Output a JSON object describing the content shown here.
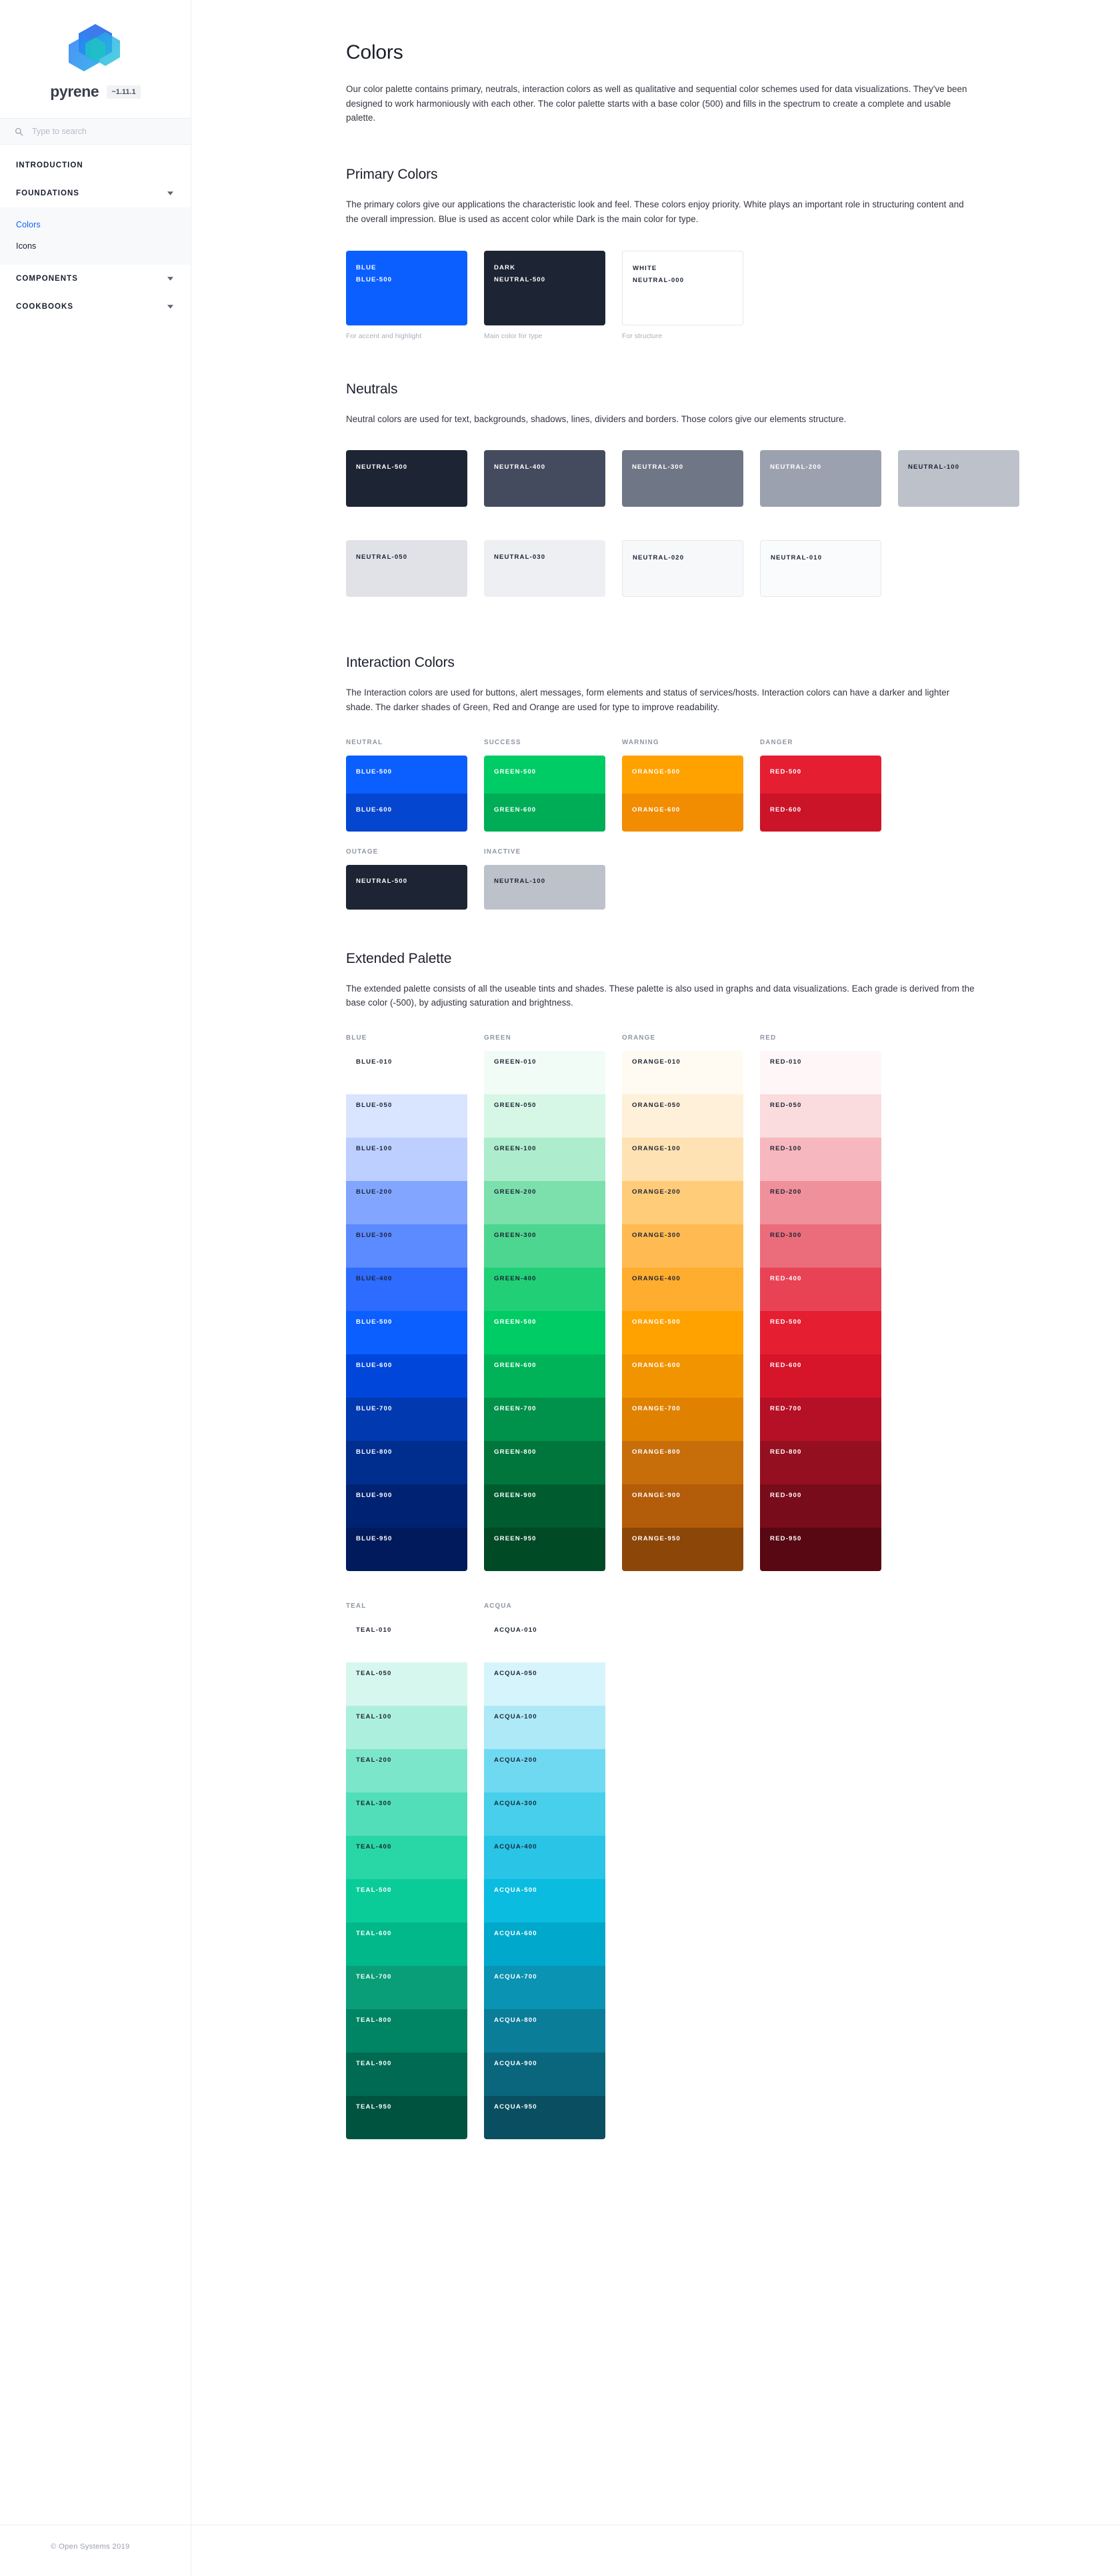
{
  "sidebar": {
    "brand": {
      "name": "pyrene",
      "version": "~1.11.1",
      "logo_icon": "pyrene-cube-logo"
    },
    "search": {
      "placeholder": "Type to search",
      "value": "",
      "icon": "search-icon"
    },
    "nav": [
      {
        "label": "INTRODUCTION",
        "expanded": false,
        "chevron": null,
        "items": []
      },
      {
        "label": "FOUNDATIONS",
        "expanded": true,
        "chevron": "chevron-up-icon",
        "items": [
          {
            "label": "Colors",
            "active": true
          },
          {
            "label": "Icons",
            "active": false
          }
        ]
      },
      {
        "label": "COMPONENTS",
        "expanded": false,
        "chevron": "chevron-down-icon",
        "items": []
      },
      {
        "label": "COOKBOOKS",
        "expanded": false,
        "chevron": "chevron-down-icon",
        "items": []
      }
    ]
  },
  "page": {
    "title": "Colors",
    "lede": "Our color palette contains primary, neutrals, interaction colors as well as qualitative and sequential color schemes used for data visualizations. They've been designed to work harmoniously with each other. The color palette starts with a base color (500) and fills in the spectrum to create a complete and usable palette."
  },
  "primary": {
    "title": "Primary Colors",
    "description": "The primary colors give our applications the characteristic look and feel. These colors enjoy priority. White plays an important role in structuring content and the overall impression. Blue is used as accent color while Dark is the main color for type.",
    "swatches": [
      {
        "name": "BLUE",
        "token": "BLUE-500",
        "hex": "#0B5FFF",
        "text": "#FFFFFF",
        "caption": "For accent and highlight",
        "bordered": false
      },
      {
        "name": "DARK",
        "token": "NEUTRAL-500",
        "hex": "#1D2433",
        "text": "#FFFFFF",
        "caption": "Main color for type",
        "bordered": false
      },
      {
        "name": "WHITE",
        "token": "NEUTRAL-000",
        "hex": "#FFFFFF",
        "text": "#1D2433",
        "caption": "For structure",
        "bordered": true
      }
    ]
  },
  "neutrals": {
    "title": "Neutrals",
    "description": "Neutral colors are used for text, backgrounds, shadows, lines, dividers and borders. Those colors give our elements structure.",
    "swatches": [
      {
        "token": "NEUTRAL-500",
        "hex": "#1D2433",
        "text": "#FFFFFF",
        "bordered": false
      },
      {
        "token": "NEUTRAL-400",
        "hex": "#454B5E",
        "text": "#FFFFFF",
        "bordered": false
      },
      {
        "token": "NEUTRAL-300",
        "hex": "#6F7685",
        "text": "#FFFFFF",
        "bordered": false
      },
      {
        "token": "NEUTRAL-200",
        "hex": "#9BA1AE",
        "text": "#FFFFFF",
        "bordered": false
      },
      {
        "token": "NEUTRAL-100",
        "hex": "#BCC1CA",
        "text": "#1D2433",
        "bordered": false
      },
      {
        "token": "NEUTRAL-050",
        "hex": "#E0E2E7",
        "text": "#1D2433",
        "bordered": false
      },
      {
        "token": "NEUTRAL-030",
        "hex": "#EDEFF2",
        "text": "#1D2433",
        "bordered": false
      },
      {
        "token": "NEUTRAL-020",
        "hex": "#F6F8FA",
        "text": "#1D2433",
        "bordered": true
      },
      {
        "token": "NEUTRAL-010",
        "hex": "#FAFBFC",
        "text": "#1D2433",
        "bordered": true
      }
    ]
  },
  "interaction": {
    "title": "Interaction Colors",
    "description": "The Interaction colors are used for buttons, alert messages, form elements and status of services/hosts. Interaction colors can have a darker and lighter shade. The darker shades of Green, Red and Orange are used for type to improve readability.",
    "groups": [
      {
        "label": "NEUTRAL",
        "shades": [
          {
            "token": "BLUE-500",
            "hex": "#0B5FFF",
            "text": "#FFFFFF"
          },
          {
            "token": "BLUE-600",
            "hex": "#0546D1",
            "text": "#FFFFFF"
          }
        ]
      },
      {
        "label": "SUCCESS",
        "shades": [
          {
            "token": "GREEN-500",
            "hex": "#00CC66",
            "text": "#FFFFFF"
          },
          {
            "token": "GREEN-600",
            "hex": "#00AD57",
            "text": "#FFFFFF"
          }
        ]
      },
      {
        "label": "WARNING",
        "shades": [
          {
            "token": "ORANGE-500",
            "hex": "#FFA200",
            "text": "#FFFFFF"
          },
          {
            "token": "ORANGE-600",
            "hex": "#F28C00",
            "text": "#FFFFFF"
          }
        ]
      },
      {
        "label": "DANGER",
        "shades": [
          {
            "token": "RED-500",
            "hex": "#E61E32",
            "text": "#FFFFFF"
          },
          {
            "token": "RED-600",
            "hex": "#CC1428",
            "text": "#FFFFFF"
          }
        ]
      }
    ],
    "status": [
      {
        "label": "OUTAGE",
        "token": "NEUTRAL-500",
        "hex": "#1D2433",
        "text": "#FFFFFF"
      },
      {
        "label": "INACTIVE",
        "token": "NEUTRAL-100",
        "hex": "#BCC1CA",
        "text": "#1D2433"
      }
    ]
  },
  "extended": {
    "title": "Extended Palette",
    "description": "The extended palette consists of all the useable tints and shades. These palette is also used in graphs and data visualizations. Each grade is derived from the base color (-500), by adjusting saturation and brightness.",
    "row1": [
      {
        "label": "BLUE",
        "cells": [
          {
            "token": "BLUE-010",
            "hex": "#FFFFFF",
            "text": "#1D2433"
          },
          {
            "token": "BLUE-050",
            "hex": "#D9E4FF",
            "text": "#1D2433"
          },
          {
            "token": "BLUE-100",
            "hex": "#BCCFFF",
            "text": "#1D2433"
          },
          {
            "token": "BLUE-200",
            "hex": "#82A6FF",
            "text": "#1D2433"
          },
          {
            "token": "BLUE-300",
            "hex": "#5C8AFF",
            "text": "#1D2433"
          },
          {
            "token": "BLUE-400",
            "hex": "#2E6BFF",
            "text": "#1D2433"
          },
          {
            "token": "BLUE-500",
            "hex": "#0B5FFF",
            "text": "#FFFFFF"
          },
          {
            "token": "BLUE-600",
            "hex": "#0046DB",
            "text": "#FFFFFF"
          },
          {
            "token": "BLUE-700",
            "hex": "#0039B0",
            "text": "#FFFFFF"
          },
          {
            "token": "BLUE-800",
            "hex": "#002E8F",
            "text": "#FFFFFF"
          },
          {
            "token": "BLUE-900",
            "hex": "#002272",
            "text": "#FFFFFF"
          },
          {
            "token": "BLUE-950",
            "hex": "#001A5C",
            "text": "#FFFFFF"
          }
        ]
      },
      {
        "label": "GREEN",
        "cells": [
          {
            "token": "GREEN-010",
            "hex": "#F2FCF7",
            "text": "#1D2433"
          },
          {
            "token": "GREEN-050",
            "hex": "#D6F7E6",
            "text": "#1D2433"
          },
          {
            "token": "GREEN-100",
            "hex": "#ADEDCD",
            "text": "#1D2433"
          },
          {
            "token": "GREEN-200",
            "hex": "#7CE0AD",
            "text": "#1D2433"
          },
          {
            "token": "GREEN-300",
            "hex": "#4DD68F",
            "text": "#1D2433"
          },
          {
            "token": "GREEN-400",
            "hex": "#21CF77",
            "text": "#1D2433"
          },
          {
            "token": "GREEN-500",
            "hex": "#00CC66",
            "text": "#FFFFFF"
          },
          {
            "token": "GREEN-600",
            "hex": "#00B359",
            "text": "#FFFFFF"
          },
          {
            "token": "GREEN-700",
            "hex": "#00914A",
            "text": "#FFFFFF"
          },
          {
            "token": "GREEN-800",
            "hex": "#00753C",
            "text": "#FFFFFF"
          },
          {
            "token": "GREEN-900",
            "hex": "#005C2F",
            "text": "#FFFFFF"
          },
          {
            "token": "GREEN-950",
            "hex": "#004A26",
            "text": "#FFFFFF"
          }
        ]
      },
      {
        "label": "ORANGE",
        "cells": [
          {
            "token": "ORANGE-010",
            "hex": "#FFFBF2",
            "text": "#1D2433"
          },
          {
            "token": "ORANGE-050",
            "hex": "#FFF0D9",
            "text": "#1D2433"
          },
          {
            "token": "ORANGE-100",
            "hex": "#FFE2B3",
            "text": "#1D2433"
          },
          {
            "token": "ORANGE-200",
            "hex": "#FFCC7A",
            "text": "#1D2433"
          },
          {
            "token": "ORANGE-300",
            "hex": "#FFBB52",
            "text": "#1D2433"
          },
          {
            "token": "ORANGE-400",
            "hex": "#FFAD2E",
            "text": "#1D2433"
          },
          {
            "token": "ORANGE-500",
            "hex": "#FFA200",
            "text": "#FFFFFF"
          },
          {
            "token": "ORANGE-600",
            "hex": "#F29400",
            "text": "#FFFFFF"
          },
          {
            "token": "ORANGE-700",
            "hex": "#E08200",
            "text": "#FFFFFF"
          },
          {
            "token": "ORANGE-800",
            "hex": "#C76D0A",
            "text": "#FFFFFF"
          },
          {
            "token": "ORANGE-900",
            "hex": "#B35C0A",
            "text": "#FFFFFF"
          },
          {
            "token": "ORANGE-950",
            "hex": "#8C4608",
            "text": "#FFFFFF"
          }
        ]
      },
      {
        "label": "RED",
        "cells": [
          {
            "token": "RED-010",
            "hex": "#FFF7F7",
            "text": "#1D2433"
          },
          {
            "token": "RED-050",
            "hex": "#FADBDE",
            "text": "#1D2433"
          },
          {
            "token": "RED-100",
            "hex": "#F7B7BE",
            "text": "#1D2433"
          },
          {
            "token": "RED-200",
            "hex": "#F0909A",
            "text": "#1D2433"
          },
          {
            "token": "RED-300",
            "hex": "#EB6C7A",
            "text": "#1D2433"
          },
          {
            "token": "RED-400",
            "hex": "#E84355",
            "text": "#FFFFFF"
          },
          {
            "token": "RED-500",
            "hex": "#E61E32",
            "text": "#FFFFFF"
          },
          {
            "token": "RED-600",
            "hex": "#D6142A",
            "text": "#FFFFFF"
          },
          {
            "token": "RED-700",
            "hex": "#B51026",
            "text": "#FFFFFF"
          },
          {
            "token": "RED-800",
            "hex": "#941020",
            "text": "#FFFFFF"
          },
          {
            "token": "RED-900",
            "hex": "#780C1A",
            "text": "#FFFFFF"
          },
          {
            "token": "RED-950",
            "hex": "#570812",
            "text": "#FFFFFF"
          }
        ]
      }
    ],
    "row2": [
      {
        "label": "TEAL",
        "cells": [
          {
            "token": "TEAL-010",
            "hex": "#FFFFFF",
            "text": "#1D2433"
          },
          {
            "token": "TEAL-050",
            "hex": "#D6F7EE",
            "text": "#1D2433"
          },
          {
            "token": "TEAL-100",
            "hex": "#ADEFDD",
            "text": "#1D2433"
          },
          {
            "token": "TEAL-200",
            "hex": "#7CE6CA",
            "text": "#1D2433"
          },
          {
            "token": "TEAL-300",
            "hex": "#52DEB8",
            "text": "#1D2433"
          },
          {
            "token": "TEAL-400",
            "hex": "#29D6A6",
            "text": "#1D2433"
          },
          {
            "token": "TEAL-500",
            "hex": "#0ACC99",
            "text": "#FFFFFF"
          },
          {
            "token": "TEAL-600",
            "hex": "#00B88A",
            "text": "#FFFFFF"
          },
          {
            "token": "TEAL-700",
            "hex": "#0A9E78",
            "text": "#FFFFFF"
          },
          {
            "token": "TEAL-800",
            "hex": "#008564",
            "text": "#FFFFFF"
          },
          {
            "token": "TEAL-900",
            "hex": "#006B52",
            "text": "#FFFFFF"
          },
          {
            "token": "TEAL-950",
            "hex": "#00543F",
            "text": "#FFFFFF"
          }
        ]
      },
      {
        "label": "ACQUA",
        "cells": [
          {
            "token": "ACQUA-010",
            "hex": "#FFFFFF",
            "text": "#1D2433"
          },
          {
            "token": "ACQUA-050",
            "hex": "#D6F4FC",
            "text": "#1D2433"
          },
          {
            "token": "ACQUA-100",
            "hex": "#ADE9F7",
            "text": "#1D2433"
          },
          {
            "token": "ACQUA-200",
            "hex": "#70D9F2",
            "text": "#1D2433"
          },
          {
            "token": "ACQUA-300",
            "hex": "#47CFEB",
            "text": "#1D2433"
          },
          {
            "token": "ACQUA-400",
            "hex": "#29C4E6",
            "text": "#1D2433"
          },
          {
            "token": "ACQUA-500",
            "hex": "#0ABCE0",
            "text": "#FFFFFF"
          },
          {
            "token": "ACQUA-600",
            "hex": "#00A8CC",
            "text": "#FFFFFF"
          },
          {
            "token": "ACQUA-700",
            "hex": "#0A93B3",
            "text": "#FFFFFF"
          },
          {
            "token": "ACQUA-800",
            "hex": "#0A7D99",
            "text": "#FFFFFF"
          },
          {
            "token": "ACQUA-900",
            "hex": "#0A667D",
            "text": "#FFFFFF"
          },
          {
            "token": "ACQUA-950",
            "hex": "#0A4F61",
            "text": "#FFFFFF"
          }
        ]
      }
    ]
  },
  "footer": {
    "copyright": "© Open Systems 2019"
  }
}
